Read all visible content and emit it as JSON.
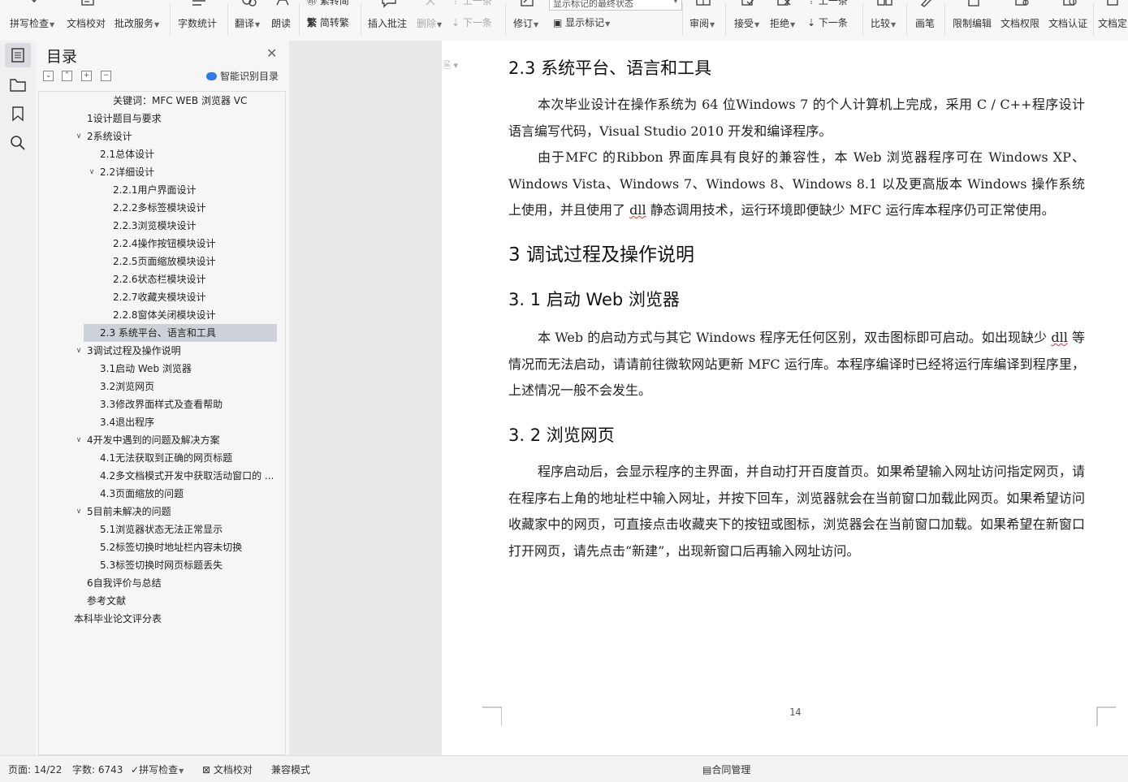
{
  "ribbon": {
    "spell_check": "拼写检查",
    "doc_proofread": "文档校对",
    "review_service": "批改服务",
    "word_count": "字数统计",
    "translate": "翻译",
    "read_aloud": "朗读",
    "trad_simp_top": "繁转简",
    "simp_trad": "简转繁",
    "insert_comment": "插入批注",
    "delete": "删除",
    "prev_comment": "上一条",
    "next_comment": "下一条",
    "track_changes": "修订",
    "markup_mode": "显示标记的最终状态",
    "show_markup": "显示标记",
    "review": "审阅",
    "accept": "接受",
    "reject": "拒绝",
    "prev_change": "上一条",
    "next_change": "下一条",
    "compare": "比较",
    "pen": "画笔",
    "restrict_edit": "限制编辑",
    "doc_permission": "文档权限",
    "doc_cert": "文档认证",
    "doc_final": "文档定"
  },
  "toc": {
    "title": "目录",
    "smart_button": "智能识别目录",
    "items": [
      {
        "text": "关键词：MFC WEB 浏览器 VC",
        "level": 3,
        "toggle": ""
      },
      {
        "text": "1设计题目与要求",
        "level": 1,
        "toggle": ""
      },
      {
        "text": "2系统设计",
        "level": 1,
        "toggle": "⌵"
      },
      {
        "text": "2.1总体设计",
        "level": 2,
        "toggle": ""
      },
      {
        "text": "2.2详细设计",
        "level": 2,
        "toggle": "⌵"
      },
      {
        "text": "2.2.1用户界面设计",
        "level": 3,
        "toggle": ""
      },
      {
        "text": "2.2.2多标签模块设计",
        "level": 3,
        "toggle": ""
      },
      {
        "text": "2.2.3浏览模块设计",
        "level": 3,
        "toggle": ""
      },
      {
        "text": "2.2.4操作按钮模块设计",
        "level": 3,
        "toggle": ""
      },
      {
        "text": "2.2.5页面缩放模块设计",
        "level": 3,
        "toggle": ""
      },
      {
        "text": "2.2.6状态栏模块设计",
        "level": 3,
        "toggle": ""
      },
      {
        "text": "2.2.7收藏夹模块设计",
        "level": 3,
        "toggle": ""
      },
      {
        "text": "2.2.8窗体关闭模块设计",
        "level": 3,
        "toggle": ""
      },
      {
        "text": "2.3 系统平台、语言和工具",
        "level": 2,
        "toggle": "",
        "selected": true
      },
      {
        "text": "3调试过程及操作说明",
        "level": 1,
        "toggle": "⌵"
      },
      {
        "text": "3.1启动 Web 浏览器",
        "level": 2,
        "toggle": ""
      },
      {
        "text": "3.2浏览网页",
        "level": 2,
        "toggle": ""
      },
      {
        "text": "3.3修改界面样式及查看帮助",
        "level": 2,
        "toggle": ""
      },
      {
        "text": "3.4退出程序",
        "level": 2,
        "toggle": ""
      },
      {
        "text": "4开发中遇到的问题及解决方案",
        "level": 1,
        "toggle": "⌵"
      },
      {
        "text": "4.1无法获取到正确的网页标题",
        "level": 2,
        "toggle": ""
      },
      {
        "text": "4.2多文档模式开发中获取活动窗口的 ...",
        "level": 2,
        "toggle": ""
      },
      {
        "text": "4.3页面缩放的问题",
        "level": 2,
        "toggle": ""
      },
      {
        "text": "5目前未解决的问题",
        "level": 1,
        "toggle": "⌵"
      },
      {
        "text": "5.1浏览器状态无法正常显示",
        "level": 2,
        "toggle": ""
      },
      {
        "text": "5.2标签切换时地址栏内容未切换",
        "level": 2,
        "toggle": ""
      },
      {
        "text": "5.3标签切换时网页标题丢失",
        "level": 2,
        "toggle": ""
      },
      {
        "text": "6自我评价与总结",
        "level": 1,
        "toggle": ""
      },
      {
        "text": "参考文献",
        "level": 1,
        "toggle": ""
      },
      {
        "text": "本科毕业论文评分表",
        "level": 0,
        "toggle": ""
      }
    ]
  },
  "document": {
    "h_2_3": "2.3 系统平台、语言和工具",
    "p1": "本次毕业设计在操作系统为 64 位Windows 7 的个人计算机上完成，采用 C / C++程序设计语言编写代码，Visual Studio 2010 开发和编译程序。",
    "p2_a": "由于MFC 的Ribbon 界面库具有良好的兼容性，本 Web 浏览器程序可在 Windows XP、Windows Vista、Windows 7、Windows 8、Windows 8.1 以及更高版本 Windows 操作系统上使用，并且使用了 ",
    "p2_dll": "dll",
    "p2_b": " 静态调用技术，运行环境即便缺少 MFC 运行库本程序仍可正常使用。",
    "h_3": "3   调试过程及操作说明",
    "h_3_1": "3. 1   启动 Web 浏览器",
    "p3_a": "本 Web 的启动方式与其它 Windows 程序无任何区别，双击图标即可启动。如出现缺少 ",
    "p3_dll": "dll",
    "p3_b": " 等情况而无法启动，请请前往微软网站更新 MFC 运行库。本程序编译时已经将运行库编译到程序里，上述情况一般不会发生。",
    "h_3_2": "3. 2   浏览网页",
    "p4": "程序启动后，会显示程序的主界面，并自动打开百度首页。如果希望输入网址访问指定网页，请在程序右上角的地址栏中输入网址，并按下回车，浏览器就会在当前窗口加载此网页。如果希望访问收藏家中的网页，可直接点击收藏夹下的按钮或图标，浏览器会在当前窗口加载。如果希望在新窗口打开网页，请先点击“新建”，出现新窗口后再输入网址访问。",
    "page_number": "14"
  },
  "status": {
    "page": "页面: 14/22",
    "words": "字数: 6743",
    "spell_check": "拼写检查",
    "proofread": "文档校对",
    "compat_mode": "兼容模式",
    "contract": "合同管理"
  }
}
